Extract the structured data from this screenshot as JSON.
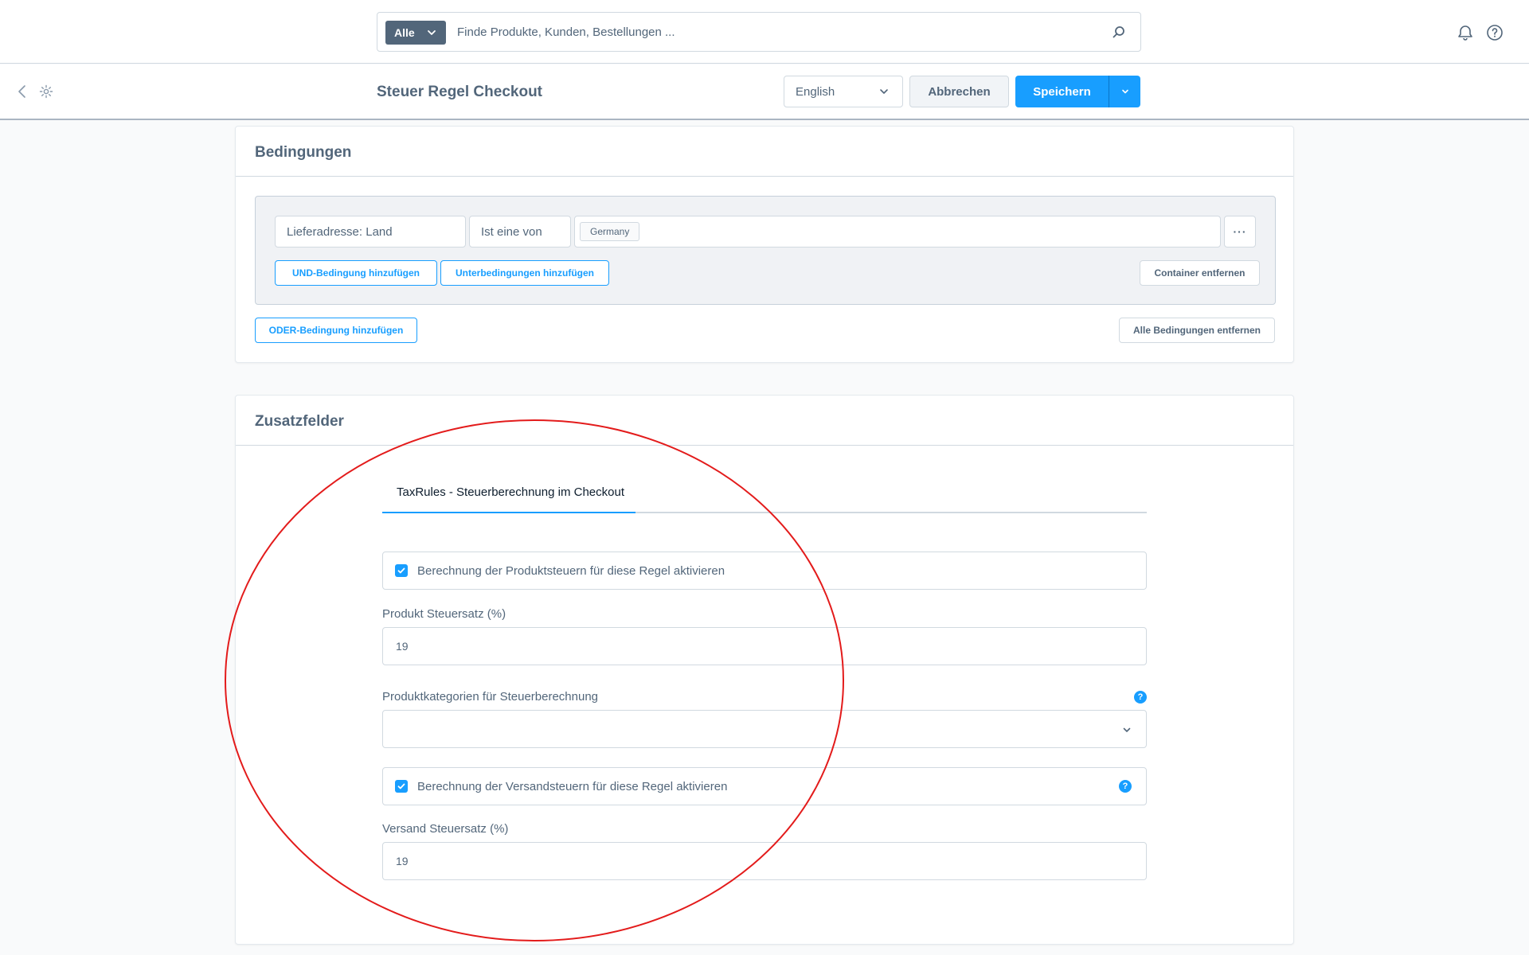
{
  "search": {
    "type_label": "Alle",
    "placeholder": "Finde Produkte, Kunden, Bestellungen ..."
  },
  "smartbar": {
    "title": "Steuer Regel Checkout",
    "language": "English",
    "cancel_label": "Abbrechen",
    "save_label": "Speichern"
  },
  "conditions": {
    "title": "Bedingungen",
    "field": "Lieferadresse: Land",
    "operator": "Ist eine von",
    "values": [
      "Germany"
    ],
    "and_label": "UND-Bedingung hinzufügen",
    "sub_label": "Unterbedingungen hinzufügen",
    "remove_container_label": "Container entfernen",
    "or_label": "ODER-Bedingung hinzufügen",
    "remove_all_label": "Alle Bedingungen entfernen"
  },
  "custom_fields": {
    "title": "Zusatzfelder",
    "tab": "TaxRules - Steuerberechnung im Checkout",
    "product_tax_checkbox": "Berechnung der Produktsteuern für diese Regel aktivieren",
    "product_tax_checked": true,
    "product_rate_label": "Produkt Steuersatz (%)",
    "product_rate_value": "19",
    "categories_label": "Produktkategorien für Steuerberechnung",
    "categories_value": "",
    "shipping_tax_checkbox": "Berechnung der Versandsteuern für diese Regel aktivieren",
    "shipping_tax_checked": true,
    "shipping_rate_label": "Versand Steuersatz (%)",
    "shipping_rate_value": "19"
  },
  "colors": {
    "accent": "#189eff",
    "text": "#52667a",
    "annotation": "#e31b1b"
  },
  "icons": [
    "chevron-down-icon",
    "search-icon",
    "bell-icon",
    "help-icon",
    "back-arrow-icon",
    "gear-icon",
    "checkmark-icon",
    "ellipsis-icon",
    "help-badge-icon"
  ]
}
